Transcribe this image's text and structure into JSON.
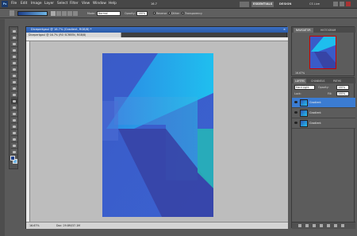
{
  "menubar": {
    "logo": "Ps",
    "items": [
      "File",
      "Edit",
      "Image",
      "Layer",
      "Select",
      "Filter",
      "View",
      "Window",
      "Help"
    ],
    "zoom": "16.7",
    "workspaces": [
      "ESSENTIALS",
      "DESIGN"
    ],
    "active_workspace": "ESSENTIALS",
    "cs_live": "CS Live"
  },
  "options": {
    "mode_label": "Mode:",
    "mode_value": "Normal",
    "opacity_label": "Opacity:",
    "opacity_value": "100%",
    "reverse": "Reverse",
    "dither": "Dither",
    "transparency": "Transparency"
  },
  "document": {
    "title": "Dicepertgaul @ 16.7% (Gradient, RGB/8) *",
    "tab": "Dicepertgaul @ 16.7% (RO SCREEN, RGB/8)",
    "close": "×",
    "status_zoom": "16.67%",
    "status_doc": "Doc: 29.8M/37.1M"
  },
  "navigator": {
    "tabs": [
      "NAVIGATOR",
      "HISTOGRAM"
    ],
    "zoom": "16.67%"
  },
  "layers": {
    "tabs": [
      "LAYERS",
      "CHANNELS",
      "PATHS"
    ],
    "blend_mode": "Hard Light",
    "opacity_label": "Opacity:",
    "opacity_value": "100%",
    "lock_label": "Lock:",
    "fill_label": "Fill:",
    "fill_value": "100%",
    "items": [
      {
        "name": "Gradient",
        "selected": true
      },
      {
        "name": "Gradient",
        "selected": false
      },
      {
        "name": "Gradient",
        "selected": false
      }
    ]
  },
  "colors": {
    "foreground": "#1d3f8a",
    "background": "#6fb6e6",
    "selected_layer": "#3b7cd2"
  }
}
